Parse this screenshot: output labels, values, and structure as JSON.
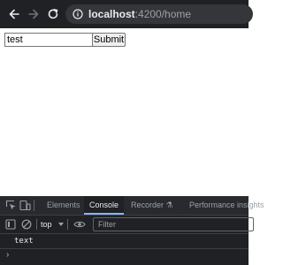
{
  "browser": {
    "url_host": "localhost",
    "url_rest": ":4200/home",
    "icons": [
      "back-arrow-icon",
      "forward-arrow-icon",
      "reload-icon",
      "site-info-icon"
    ]
  },
  "page": {
    "input_value": "test",
    "submit_label": "Submit"
  },
  "devtools": {
    "tabs": [
      {
        "label": "Elements"
      },
      {
        "label": "Console",
        "active": true
      },
      {
        "label": "Recorder ⚗"
      },
      {
        "label": "Performance insights"
      }
    ],
    "context": "top",
    "filter_placeholder": "Filter",
    "console_lines": [
      "text"
    ],
    "prompt": "›",
    "accent": "#8ab4f8"
  }
}
